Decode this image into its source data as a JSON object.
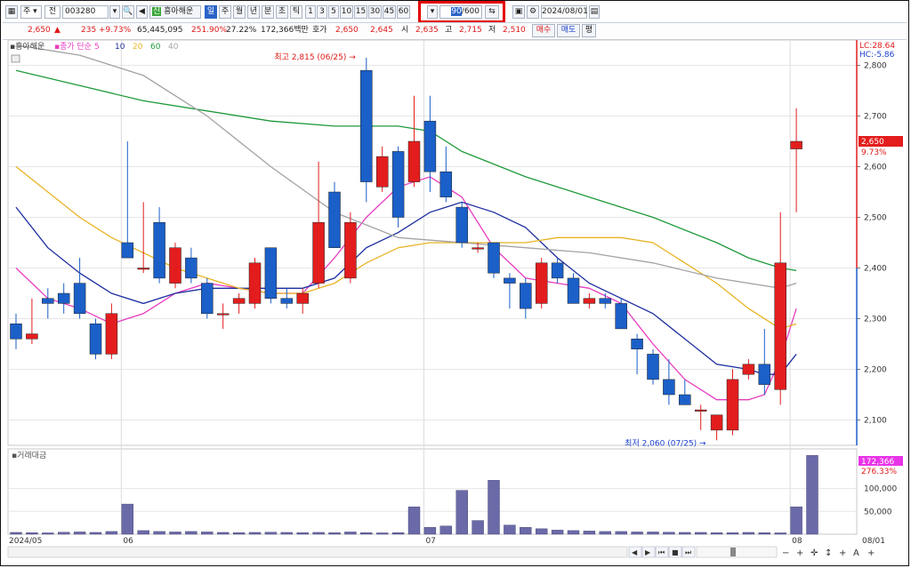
{
  "toolbar": {
    "period_type": "주",
    "all_label": "전",
    "code": "003280",
    "name": "흥아해운",
    "name_badge": "신",
    "interval_day": "일",
    "interval_week": "주",
    "interval_month": "월",
    "interval_year": "년",
    "interval_min": "분",
    "interval_sec": "초",
    "interval_tick": "틱",
    "minute_options": [
      "1",
      "3",
      "5",
      "10",
      "15",
      "30",
      "45",
      "60"
    ],
    "count_value": "90",
    "count_max": "/600",
    "date": "2024/08/01"
  },
  "quote": {
    "price": "2,650",
    "change_arrow": "▲",
    "change": "235",
    "change_pct": "+9.73%",
    "volume": "65,445,095",
    "volume_ratio": "251.90%",
    "turnover": "27.22%",
    "amount": "172,366백만",
    "hoga_label": "호가",
    "ask": "2,650",
    "bid": "2,645",
    "open_label": "시",
    "open": "2,635",
    "high_label": "고",
    "high": "2,715",
    "low_label": "저",
    "low": "2,510",
    "buy_button": "매수",
    "sell_button": "매도",
    "eval_button": "평"
  },
  "legend": {
    "stock": "흥아해운",
    "ma_label": "종가 단순",
    "ma_periods": [
      "5",
      "10",
      "20",
      "60",
      "40"
    ],
    "ma_colors": [
      "#e83cc0",
      "#1b2d9e",
      "#e8b323",
      "#1f9a3a",
      "#a3a3a3"
    ]
  },
  "volume_legend": "거래대금",
  "chart_data": {
    "type": "candlestick",
    "title": "흥아해운",
    "y_axis": {
      "min": 2050,
      "max": 2850,
      "ticks": [
        2100,
        2200,
        2300,
        2400,
        2500,
        2600,
        2700,
        2800
      ],
      "tick_labels": [
        "2,100",
        "2,200",
        "2,300",
        "2,400",
        "2,500",
        "2,600",
        "2,700",
        "2,800"
      ]
    },
    "x_labels": [
      "2024/05",
      "06",
      "07",
      "08",
      "08/01"
    ],
    "x_label_index": [
      0,
      7,
      26,
      49,
      53
    ],
    "up_color": "#e31d1d",
    "down_color": "#1b5fc8",
    "candles": [
      {
        "o": 2290,
        "h": 2310,
        "l": 2240,
        "c": 2260
      },
      {
        "o": 2260,
        "h": 2340,
        "l": 2250,
        "c": 2270
      },
      {
        "o": 2340,
        "h": 2360,
        "l": 2300,
        "c": 2330
      },
      {
        "o": 2350,
        "h": 2370,
        "l": 2310,
        "c": 2330
      },
      {
        "o": 2370,
        "h": 2420,
        "l": 2300,
        "c": 2310
      },
      {
        "o": 2290,
        "h": 2300,
        "l": 2220,
        "c": 2230
      },
      {
        "o": 2230,
        "h": 2330,
        "l": 2220,
        "c": 2310
      },
      {
        "o": 2450,
        "h": 2650,
        "l": 2420,
        "c": 2420
      },
      {
        "o": 2400,
        "h": 2530,
        "l": 2390,
        "c": 2400
      },
      {
        "o": 2490,
        "h": 2520,
        "l": 2370,
        "c": 2380
      },
      {
        "o": 2370,
        "h": 2450,
        "l": 2360,
        "c": 2440
      },
      {
        "o": 2420,
        "h": 2440,
        "l": 2370,
        "c": 2380
      },
      {
        "o": 2370,
        "h": 2380,
        "l": 2300,
        "c": 2310
      },
      {
        "o": 2310,
        "h": 2330,
        "l": 2280,
        "c": 2310
      },
      {
        "o": 2330,
        "h": 2350,
        "l": 2310,
        "c": 2340
      },
      {
        "o": 2330,
        "h": 2420,
        "l": 2320,
        "c": 2410
      },
      {
        "o": 2440,
        "h": 2440,
        "l": 2330,
        "c": 2340
      },
      {
        "o": 2340,
        "h": 2360,
        "l": 2320,
        "c": 2330
      },
      {
        "o": 2330,
        "h": 2360,
        "l": 2310,
        "c": 2350
      },
      {
        "o": 2370,
        "h": 2610,
        "l": 2360,
        "c": 2490
      },
      {
        "o": 2550,
        "h": 2570,
        "l": 2440,
        "c": 2440
      },
      {
        "o": 2380,
        "h": 2510,
        "l": 2370,
        "c": 2490
      },
      {
        "o": 2790,
        "h": 2815,
        "l": 2530,
        "c": 2570
      },
      {
        "o": 2560,
        "h": 2640,
        "l": 2550,
        "c": 2620
      },
      {
        "o": 2630,
        "h": 2640,
        "l": 2480,
        "c": 2500
      },
      {
        "o": 2570,
        "h": 2740,
        "l": 2560,
        "c": 2650
      },
      {
        "o": 2690,
        "h": 2740,
        "l": 2550,
        "c": 2590
      },
      {
        "o": 2590,
        "h": 2640,
        "l": 2530,
        "c": 2540
      },
      {
        "o": 2520,
        "h": 2530,
        "l": 2440,
        "c": 2450
      },
      {
        "o": 2440,
        "h": 2450,
        "l": 2430,
        "c": 2440
      },
      {
        "o": 2450,
        "h": 2450,
        "l": 2380,
        "c": 2390
      },
      {
        "o": 2380,
        "h": 2390,
        "l": 2320,
        "c": 2370
      },
      {
        "o": 2370,
        "h": 2380,
        "l": 2300,
        "c": 2320
      },
      {
        "o": 2330,
        "h": 2420,
        "l": 2320,
        "c": 2410
      },
      {
        "o": 2410,
        "h": 2420,
        "l": 2370,
        "c": 2380
      },
      {
        "o": 2380,
        "h": 2390,
        "l": 2330,
        "c": 2330
      },
      {
        "o": 2330,
        "h": 2350,
        "l": 2320,
        "c": 2340
      },
      {
        "o": 2340,
        "h": 2350,
        "l": 2320,
        "c": 2330
      },
      {
        "o": 2330,
        "h": 2340,
        "l": 2280,
        "c": 2280
      },
      {
        "o": 2260,
        "h": 2270,
        "l": 2190,
        "c": 2240
      },
      {
        "o": 2230,
        "h": 2240,
        "l": 2170,
        "c": 2180
      },
      {
        "o": 2180,
        "h": 2220,
        "l": 2130,
        "c": 2150
      },
      {
        "o": 2150,
        "h": 2180,
        "l": 2130,
        "c": 2130
      },
      {
        "o": 2120,
        "h": 2130,
        "l": 2080,
        "c": 2120
      },
      {
        "o": 2080,
        "h": 2110,
        "l": 2060,
        "c": 2110
      },
      {
        "o": 2080,
        "h": 2200,
        "l": 2070,
        "c": 2180
      },
      {
        "o": 2190,
        "h": 2220,
        "l": 2180,
        "c": 2210
      },
      {
        "o": 2210,
        "h": 2280,
        "l": 2150,
        "c": 2170
      },
      {
        "o": 2160,
        "h": 2510,
        "l": 2130,
        "c": 2410
      },
      {
        "o": 2635,
        "h": 2715,
        "l": 2510,
        "c": 2650
      }
    ],
    "moving_averages": [
      {
        "period": "5",
        "color": "#e83cc0",
        "points": [
          [
            0,
            2400
          ],
          [
            2,
            2340
          ],
          [
            4,
            2320
          ],
          [
            6,
            2290
          ],
          [
            8,
            2310
          ],
          [
            10,
            2350
          ],
          [
            12,
            2370
          ],
          [
            14,
            2360
          ],
          [
            16,
            2350
          ],
          [
            18,
            2350
          ],
          [
            20,
            2420
          ],
          [
            22,
            2500
          ],
          [
            24,
            2560
          ],
          [
            26,
            2580
          ],
          [
            28,
            2540
          ],
          [
            30,
            2440
          ],
          [
            32,
            2380
          ],
          [
            34,
            2370
          ],
          [
            36,
            2360
          ],
          [
            38,
            2330
          ],
          [
            40,
            2250
          ],
          [
            42,
            2180
          ],
          [
            44,
            2140
          ],
          [
            46,
            2140
          ],
          [
            47,
            2150
          ],
          [
            48,
            2220
          ],
          [
            49,
            2320
          ]
        ]
      },
      {
        "period": "10",
        "color": "#1b2d9e",
        "points": [
          [
            0,
            2520
          ],
          [
            2,
            2440
          ],
          [
            4,
            2390
          ],
          [
            6,
            2350
          ],
          [
            8,
            2330
          ],
          [
            10,
            2350
          ],
          [
            12,
            2360
          ],
          [
            14,
            2360
          ],
          [
            16,
            2360
          ],
          [
            18,
            2360
          ],
          [
            20,
            2380
          ],
          [
            22,
            2440
          ],
          [
            24,
            2470
          ],
          [
            26,
            2510
          ],
          [
            28,
            2530
          ],
          [
            30,
            2510
          ],
          [
            32,
            2480
          ],
          [
            34,
            2420
          ],
          [
            36,
            2370
          ],
          [
            38,
            2340
          ],
          [
            40,
            2310
          ],
          [
            42,
            2260
          ],
          [
            44,
            2210
          ],
          [
            46,
            2200
          ],
          [
            47,
            2190
          ],
          [
            48,
            2190
          ],
          [
            49,
            2230
          ]
        ]
      },
      {
        "period": "20",
        "color": "#e8b323",
        "points": [
          [
            0,
            2600
          ],
          [
            2,
            2550
          ],
          [
            4,
            2500
          ],
          [
            6,
            2460
          ],
          [
            8,
            2430
          ],
          [
            10,
            2400
          ],
          [
            12,
            2380
          ],
          [
            14,
            2360
          ],
          [
            16,
            2350
          ],
          [
            18,
            2350
          ],
          [
            20,
            2370
          ],
          [
            22,
            2410
          ],
          [
            24,
            2440
          ],
          [
            26,
            2450
          ],
          [
            28,
            2450
          ],
          [
            30,
            2450
          ],
          [
            32,
            2450
          ],
          [
            34,
            2460
          ],
          [
            36,
            2460
          ],
          [
            38,
            2460
          ],
          [
            40,
            2450
          ],
          [
            42,
            2410
          ],
          [
            44,
            2370
          ],
          [
            46,
            2320
          ],
          [
            48,
            2280
          ],
          [
            49,
            2290
          ]
        ]
      },
      {
        "period": "60",
        "color": "#1f9a3a",
        "points": [
          [
            0,
            2790
          ],
          [
            4,
            2760
          ],
          [
            8,
            2730
          ],
          [
            12,
            2710
          ],
          [
            16,
            2690
          ],
          [
            20,
            2680
          ],
          [
            24,
            2680
          ],
          [
            26,
            2670
          ],
          [
            28,
            2630
          ],
          [
            32,
            2580
          ],
          [
            36,
            2540
          ],
          [
            40,
            2500
          ],
          [
            44,
            2450
          ],
          [
            46,
            2420
          ],
          [
            48,
            2400
          ],
          [
            49,
            2395
          ]
        ]
      },
      {
        "period": "40",
        "color": "#a3a3a3",
        "points": [
          [
            0,
            2840
          ],
          [
            4,
            2820
          ],
          [
            8,
            2780
          ],
          [
            12,
            2700
          ],
          [
            16,
            2600
          ],
          [
            20,
            2510
          ],
          [
            24,
            2460
          ],
          [
            28,
            2450
          ],
          [
            32,
            2440
          ],
          [
            36,
            2430
          ],
          [
            40,
            2410
          ],
          [
            44,
            2380
          ],
          [
            48,
            2360
          ],
          [
            49,
            2370
          ]
        ]
      }
    ],
    "annotations": [
      {
        "text": "최고 2,815 (06/25)",
        "index": 22,
        "value": 2815,
        "color": "#e01818"
      },
      {
        "text": "최저 2,060 (07/25)",
        "index": 44,
        "value": 2060,
        "color": "#1a3fcf"
      }
    ],
    "right_labels": {
      "lc": "LC:28.64",
      "hc": "HC:-5.86",
      "price": "2,650",
      "pct": "9.73%"
    },
    "volume": {
      "label": "거래대금",
      "ticks": [
        50000,
        100000
      ],
      "tick_labels": [
        "50,000",
        "100,000"
      ],
      "max": 175000,
      "last_label": "172,366",
      "last_pct": "276.33%",
      "values": [
        4000,
        3500,
        3000,
        4500,
        5000,
        4000,
        6000,
        66000,
        8000,
        6000,
        5000,
        6000,
        5000,
        4000,
        3500,
        4000,
        4500,
        4000,
        3500,
        4000,
        3500,
        5000,
        3500,
        3000,
        3500,
        60000,
        15000,
        18000,
        96000,
        30000,
        118000,
        20000,
        15000,
        12000,
        9000,
        8000,
        7000,
        6000,
        6000,
        5000,
        5000,
        4500,
        4000,
        4000,
        3500,
        3500,
        4000,
        3500,
        3000,
        60000,
        172366
      ]
    }
  }
}
